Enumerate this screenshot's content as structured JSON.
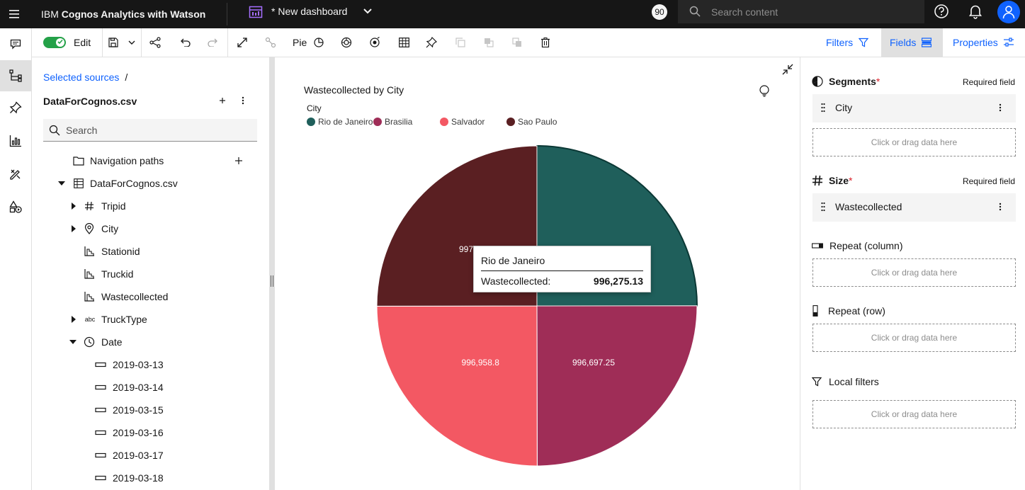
{
  "topbar": {
    "brand_prefix": "IBM ",
    "brand_bold": "Cognos Analytics with Watson",
    "dashboard_name": "* New dashboard",
    "notification_count": "90",
    "search_placeholder": "Search content"
  },
  "toolbar": {
    "edit_label": "Edit",
    "viz_type_label": "Pie",
    "filters_label": "Filters",
    "fields_label": "Fields",
    "properties_label": "Properties"
  },
  "sources": {
    "breadcrumb_link": "Selected sources",
    "breadcrumb_sep": "/",
    "source_name": "DataForCognos.csv",
    "search_placeholder": "Search",
    "tree": [
      {
        "label": "Navigation paths",
        "icon": "folder-icon",
        "caret": "none"
      },
      {
        "label": "DataForCognos.csv",
        "icon": "table-icon",
        "caret": "down"
      },
      {
        "label": "Tripid",
        "icon": "hash-icon",
        "caret": "right"
      },
      {
        "label": "City",
        "icon": "location-icon",
        "caret": "right"
      },
      {
        "label": "Stationid",
        "icon": "measure-icon",
        "caret": "none"
      },
      {
        "label": "Truckid",
        "icon": "measure-icon",
        "caret": "none"
      },
      {
        "label": "Wastecollected",
        "icon": "measure-icon",
        "caret": "none"
      },
      {
        "label": "TruckType",
        "icon": "text-abc-icon",
        "caret": "right"
      },
      {
        "label": "Date",
        "icon": "clock-icon",
        "caret": "down"
      },
      {
        "label": "2019-03-13",
        "icon": "member-icon",
        "caret": "none"
      },
      {
        "label": "2019-03-14",
        "icon": "member-icon",
        "caret": "none"
      },
      {
        "label": "2019-03-15",
        "icon": "member-icon",
        "caret": "none"
      },
      {
        "label": "2019-03-16",
        "icon": "member-icon",
        "caret": "none"
      },
      {
        "label": "2019-03-17",
        "icon": "member-icon",
        "caret": "none"
      },
      {
        "label": "2019-03-18",
        "icon": "member-icon",
        "caret": "none"
      }
    ],
    "abc_glyph": "abc"
  },
  "canvas": {
    "chart_title": "Wastecollected by City",
    "legend_title": "City",
    "tooltip": {
      "title": "Rio de Janeiro",
      "key": "Wastecollected:",
      "value": "996,275.13"
    }
  },
  "chart_data": {
    "type": "pie",
    "title": "Wastecollected by City",
    "legend_title": "City",
    "legend_placement": "top-left",
    "categories": [
      "Rio de Janeiro",
      "Brasilia",
      "Salvador",
      "Sao Paulo"
    ],
    "values": [
      996275.13,
      996697.25,
      996958.8,
      997994.16
    ],
    "labels": [
      "996,275.13",
      "996,697.25",
      "996,958.8",
      "997,994.16"
    ],
    "colors": [
      "#1f5f5b",
      "#9f2d57",
      "#f35863",
      "#5a1f22"
    ]
  },
  "fields": {
    "segments_title": "Segments",
    "size_title": "Size",
    "required_mark": "*",
    "required_text": "Required field",
    "segments_field": "City",
    "size_field": "Wastecollected",
    "repeat_column_title": "Repeat (column)",
    "repeat_row_title": "Repeat (row)",
    "local_filters_title": "Local filters",
    "drop_hint": "Click or drag data here"
  }
}
